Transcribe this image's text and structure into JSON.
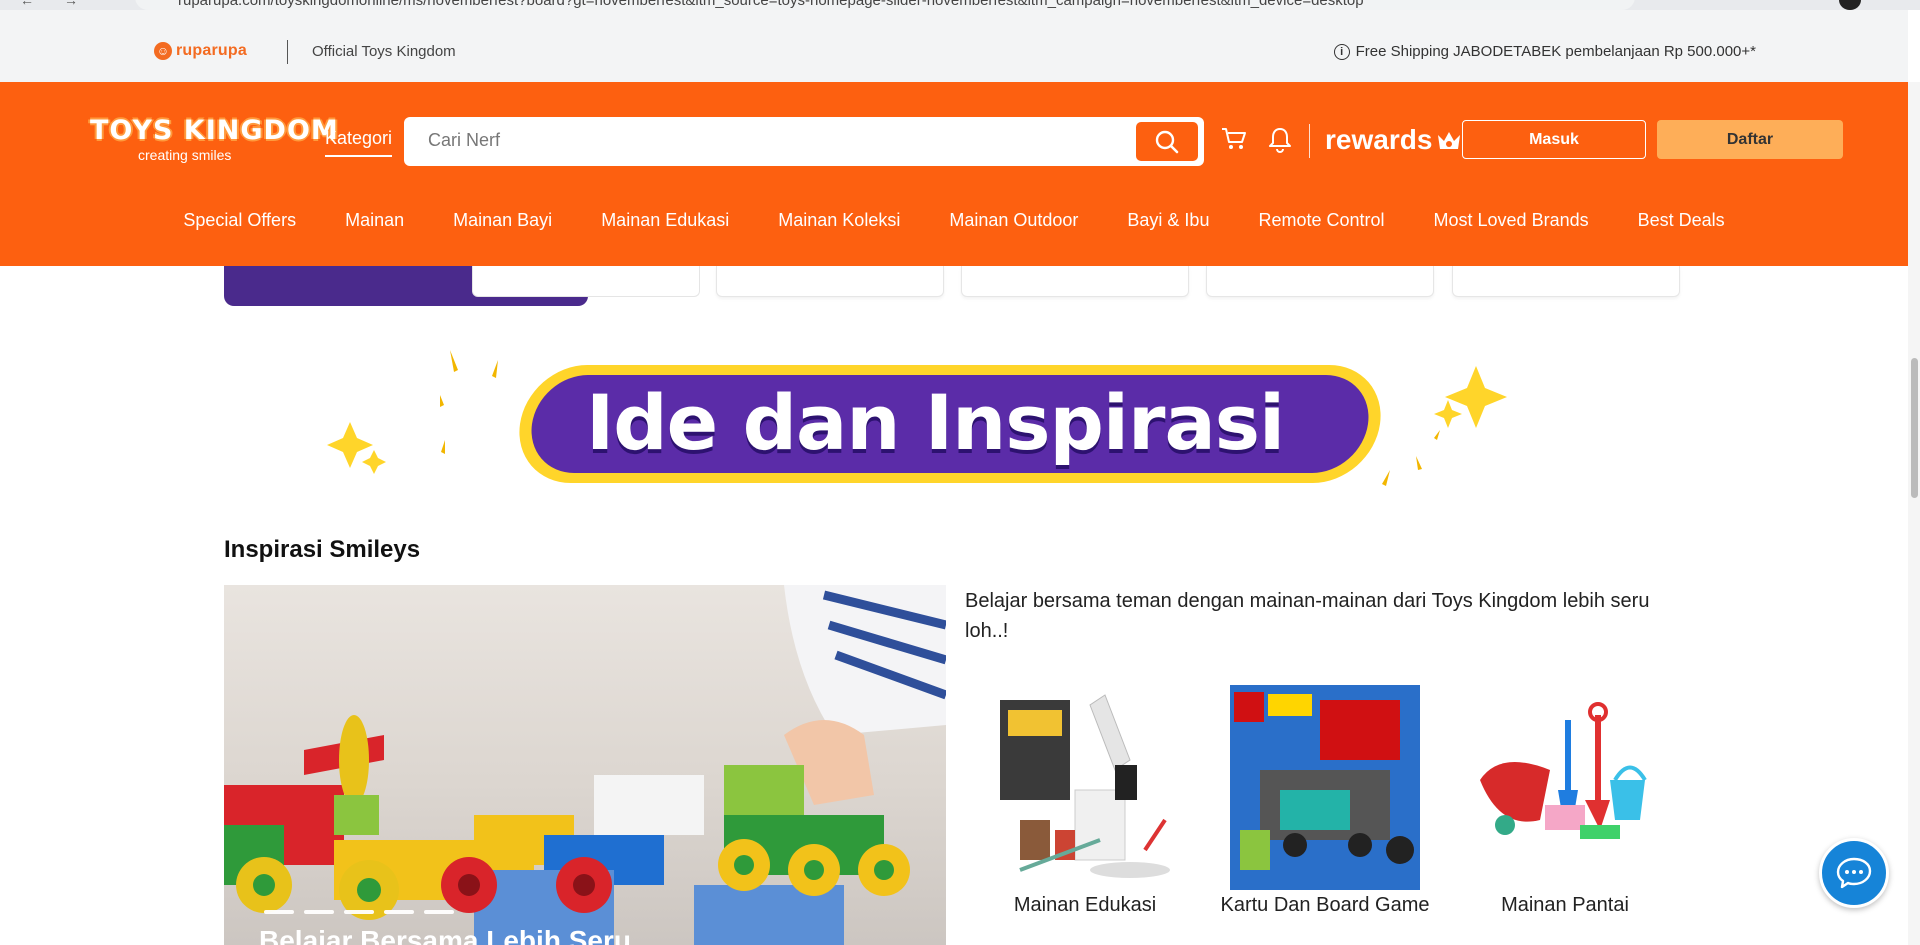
{
  "browser": {
    "url": "ruparupa.com/toyskingdomonline/ms/novemberfest?board?gt=novemberfest&itm_source=toys-homepage-slider-novemberfest&itm_campaign=novemberfest&itm_device=desktop"
  },
  "topbar": {
    "ruparupa_logo": "ruparupa",
    "official_store": "Official Toys Kingdom",
    "shipping_info": "Free Shipping JABODETABEK pembelanjaan Rp 500.000+*"
  },
  "header": {
    "logo_text": "TOYS KINGDOM",
    "logo_tagline": "creating smiles",
    "kategori_label": "Kategori",
    "search_placeholder": "Cari Nerf",
    "rewards_label": "rewards",
    "login_label": "Masuk",
    "register_label": "Daftar"
  },
  "category_nav": [
    {
      "label": "Special Offers"
    },
    {
      "label": "Mainan"
    },
    {
      "label": "Mainan Bayi"
    },
    {
      "label": "Mainan Edukasi"
    },
    {
      "label": "Mainan Koleksi"
    },
    {
      "label": "Mainan Outdoor"
    },
    {
      "label": "Bayi & Ibu"
    },
    {
      "label": "Remote Control"
    },
    {
      "label": "Most Loved Brands"
    },
    {
      "label": "Best Deals"
    }
  ],
  "banner": {
    "title": "Ide dan Inspirasi"
  },
  "inspiration": {
    "section_title": "Inspirasi Smileys",
    "hero_caption": "Belajar Bersama Lebih Seru",
    "description": "Belajar bersama teman dengan mainan-mainan dari Toys Kingdom lebih seru loh..!",
    "products": [
      {
        "label": "Mainan Edukasi"
      },
      {
        "label": "Kartu Dan Board Game"
      },
      {
        "label": "Mainan Pantai"
      }
    ]
  },
  "colors": {
    "brand_orange": "#fd6010",
    "daftar_button": "#feae58",
    "chat_blue": "#1684d8",
    "banner_purple": "#5b2ca8",
    "banner_yellow": "#ffd52a"
  }
}
